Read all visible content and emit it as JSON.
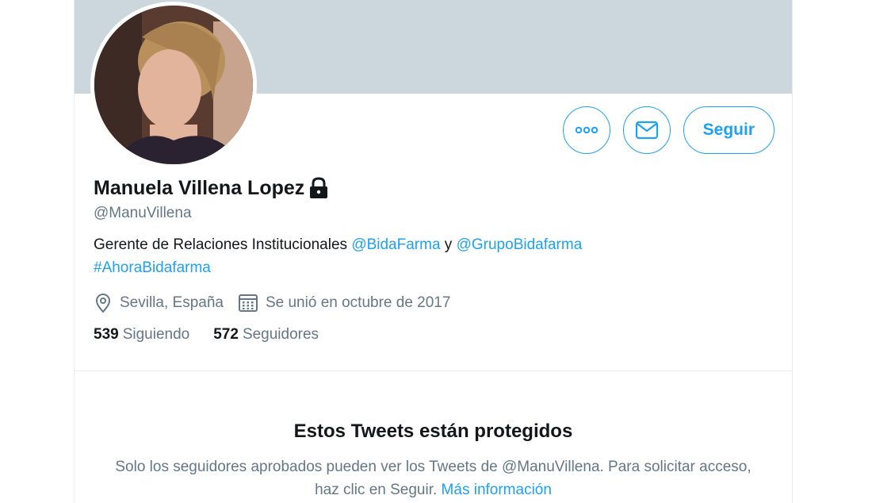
{
  "profile": {
    "name": "Manuela Villena Lopez",
    "handle": "@ManuVillena",
    "bio_prefix": "Gerente de Relaciones Institucionales ",
    "bio_mention_1": "@BidaFarma",
    "bio_connector": " y ",
    "bio_mention_2": "@GrupoBidafarma",
    "bio_hashtag": "#AhoraBidafarma",
    "location": "Sevilla, España",
    "joined": "Se unió en octubre de 2017",
    "following_count": "539",
    "following_label": "Siguiendo",
    "followers_count": "572",
    "followers_label": "Seguidores",
    "locked": true
  },
  "actions": {
    "more_icon": "more-icon",
    "message_icon": "envelope-icon",
    "follow_label": "Seguir"
  },
  "protected": {
    "title": "Estos Tweets están protegidos",
    "text": "Solo los seguidores aprobados pueden ver los Tweets de @ManuVillena. Para solicitar acceso, haz clic en Seguir. ",
    "link": "Más información"
  },
  "colors": {
    "accent": "#1da1f2",
    "banner": "#ccd6dd",
    "secondary_text": "#657786"
  }
}
